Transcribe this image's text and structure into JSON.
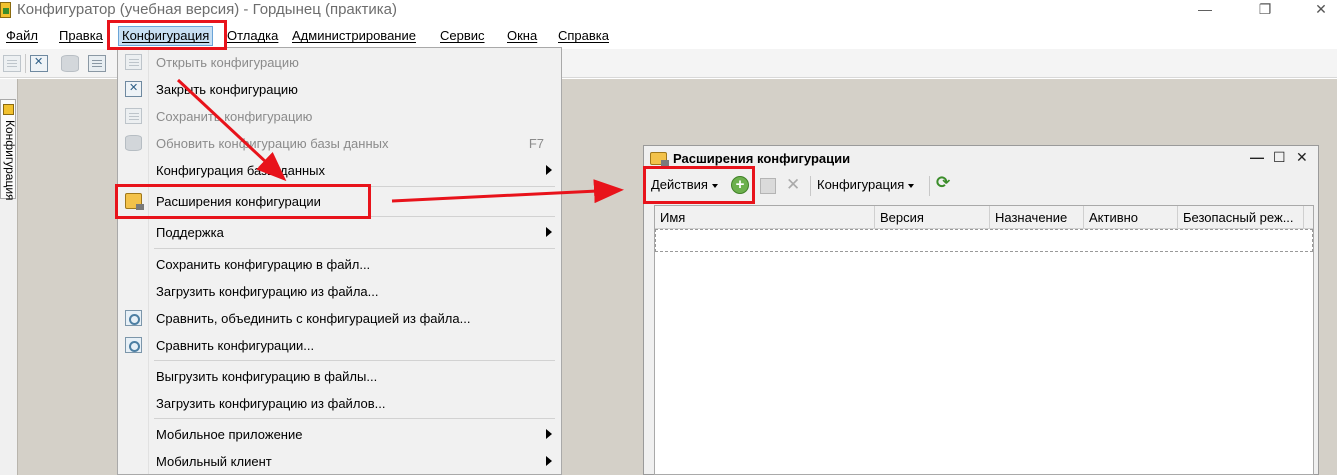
{
  "window": {
    "title": "Конфигуратор (учебная версия) - Гордынец (практика)"
  },
  "menubar": {
    "items": [
      {
        "label": "Файл"
      },
      {
        "label": "Правка"
      },
      {
        "label": "Конфигурация"
      },
      {
        "label": "Отладка"
      },
      {
        "label": "Администрирование"
      },
      {
        "label": "Сервис"
      },
      {
        "label": "Окна"
      },
      {
        "label": "Справка"
      }
    ]
  },
  "sidebar": {
    "tab_label": "Конфигурация"
  },
  "dropdown": {
    "items": [
      {
        "label": "Открыть конфигурацию",
        "icon": "open-config-icon",
        "disabled": true
      },
      {
        "label": "Закрыть конфигурацию",
        "icon": "close-config-icon"
      },
      {
        "label": "Сохранить конфигурацию",
        "icon": "save-config-icon",
        "disabled": true
      },
      {
        "label": "Обновить конфигурацию базы данных",
        "icon": "update-db-icon",
        "disabled": true,
        "shortcut": "F7"
      },
      {
        "label": "Конфигурация базы данных",
        "submenu": true
      },
      {
        "label": "Расширения конфигурации",
        "icon": "extensions-icon"
      },
      {
        "label": "Поддержка",
        "submenu": true
      },
      {
        "label": "Сохранить конфигурацию в файл..."
      },
      {
        "label": "Загрузить конфигурацию из файла..."
      },
      {
        "label": "Сравнить, объединить с конфигурацией из файла...",
        "icon": "compare-merge-icon"
      },
      {
        "label": "Сравнить конфигурации...",
        "icon": "compare-icon"
      },
      {
        "label": "Выгрузить конфигурацию в файлы..."
      },
      {
        "label": "Загрузить конфигурацию из файлов..."
      },
      {
        "label": "Мобильное приложение",
        "submenu": true
      },
      {
        "label": "Мобильный клиент",
        "submenu": true
      }
    ]
  },
  "extensions_window": {
    "title": "Расширения конфигурации",
    "toolbar": {
      "actions_label": "Действия",
      "config_label": "Конфигурация"
    },
    "columns": [
      "Имя",
      "Версия",
      "Назначение",
      "Активно",
      "Безопасный реж..."
    ]
  },
  "colors": {
    "highlight": "#e8131b",
    "workspace": "#d4d0c8",
    "menu_open": "#c7dff3"
  }
}
